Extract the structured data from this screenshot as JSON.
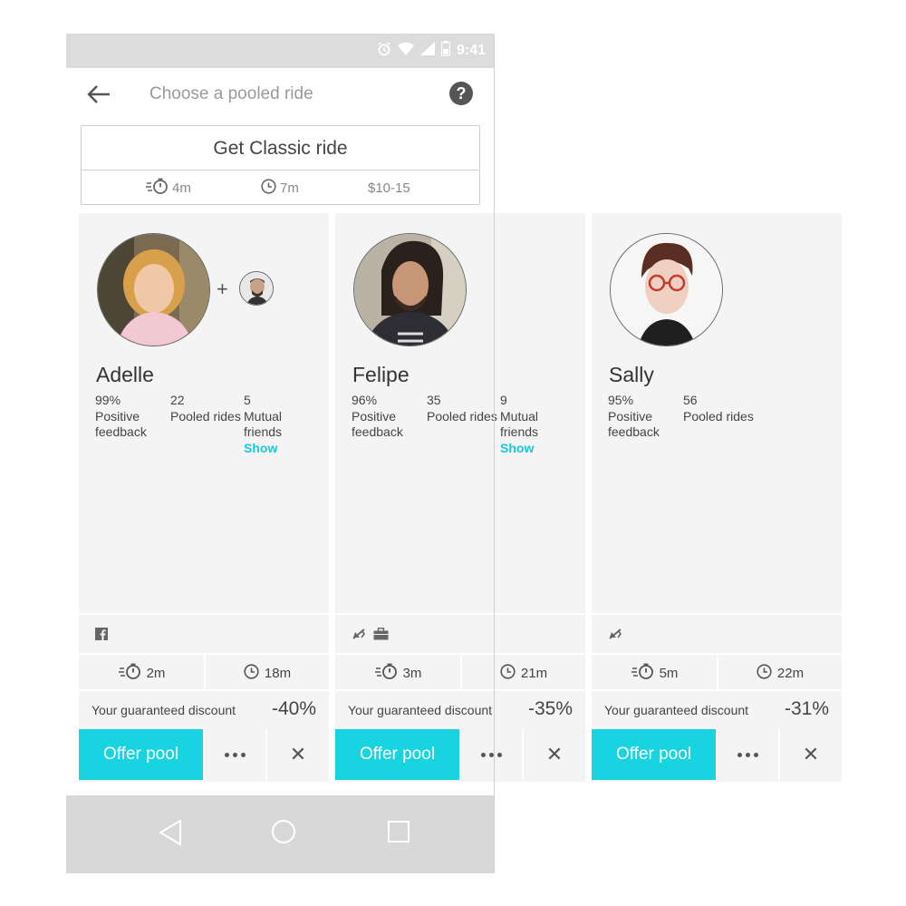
{
  "status_bar": {
    "time": "9:41"
  },
  "header": {
    "title": "Choose a pooled ride",
    "help_label": "?"
  },
  "classic": {
    "button_label": "Get Classic ride",
    "pickup_time": "4m",
    "trip_time": "7m",
    "price": "$10-15"
  },
  "cards": [
    {
      "name": "Adelle",
      "feedback_value": "99%",
      "feedback_label": "Positive feedback",
      "rides_value": "22",
      "rides_label": "Pooled rides",
      "mutual_value": "5",
      "mutual_label": "Mutual friends",
      "mutual_link": "Show",
      "pickup_time": "2m",
      "trip_time": "18m",
      "discount_label": "Your guaranteed discount",
      "discount_value": "-40%",
      "offer_label": "Offer pool",
      "close_label": "✕"
    },
    {
      "name": "Felipe",
      "feedback_value": "96%",
      "feedback_label": "Positive feedback",
      "rides_value": "35",
      "rides_label": "Pooled rides",
      "mutual_value": "9",
      "mutual_label": "Mutual friends",
      "mutual_link": "Show",
      "pickup_time": "3m",
      "trip_time": "21m",
      "discount_label": "Your guaranteed discount",
      "discount_value": "-35%",
      "offer_label": "Offer pool",
      "close_label": "✕"
    },
    {
      "name": "Sally",
      "feedback_value": "95%",
      "feedback_label": "Positive feedback",
      "rides_value": "56",
      "rides_label": "Pooled rides",
      "pickup_time": "5m",
      "trip_time": "22m",
      "discount_label": "Your guaranteed discount",
      "discount_value": "-31%",
      "offer_label": "Offer pool",
      "close_label": "✕"
    }
  ],
  "colors": {
    "accent": "#18d3e0",
    "link": "#18c8dd",
    "card_bg": "#f4f4f4"
  }
}
